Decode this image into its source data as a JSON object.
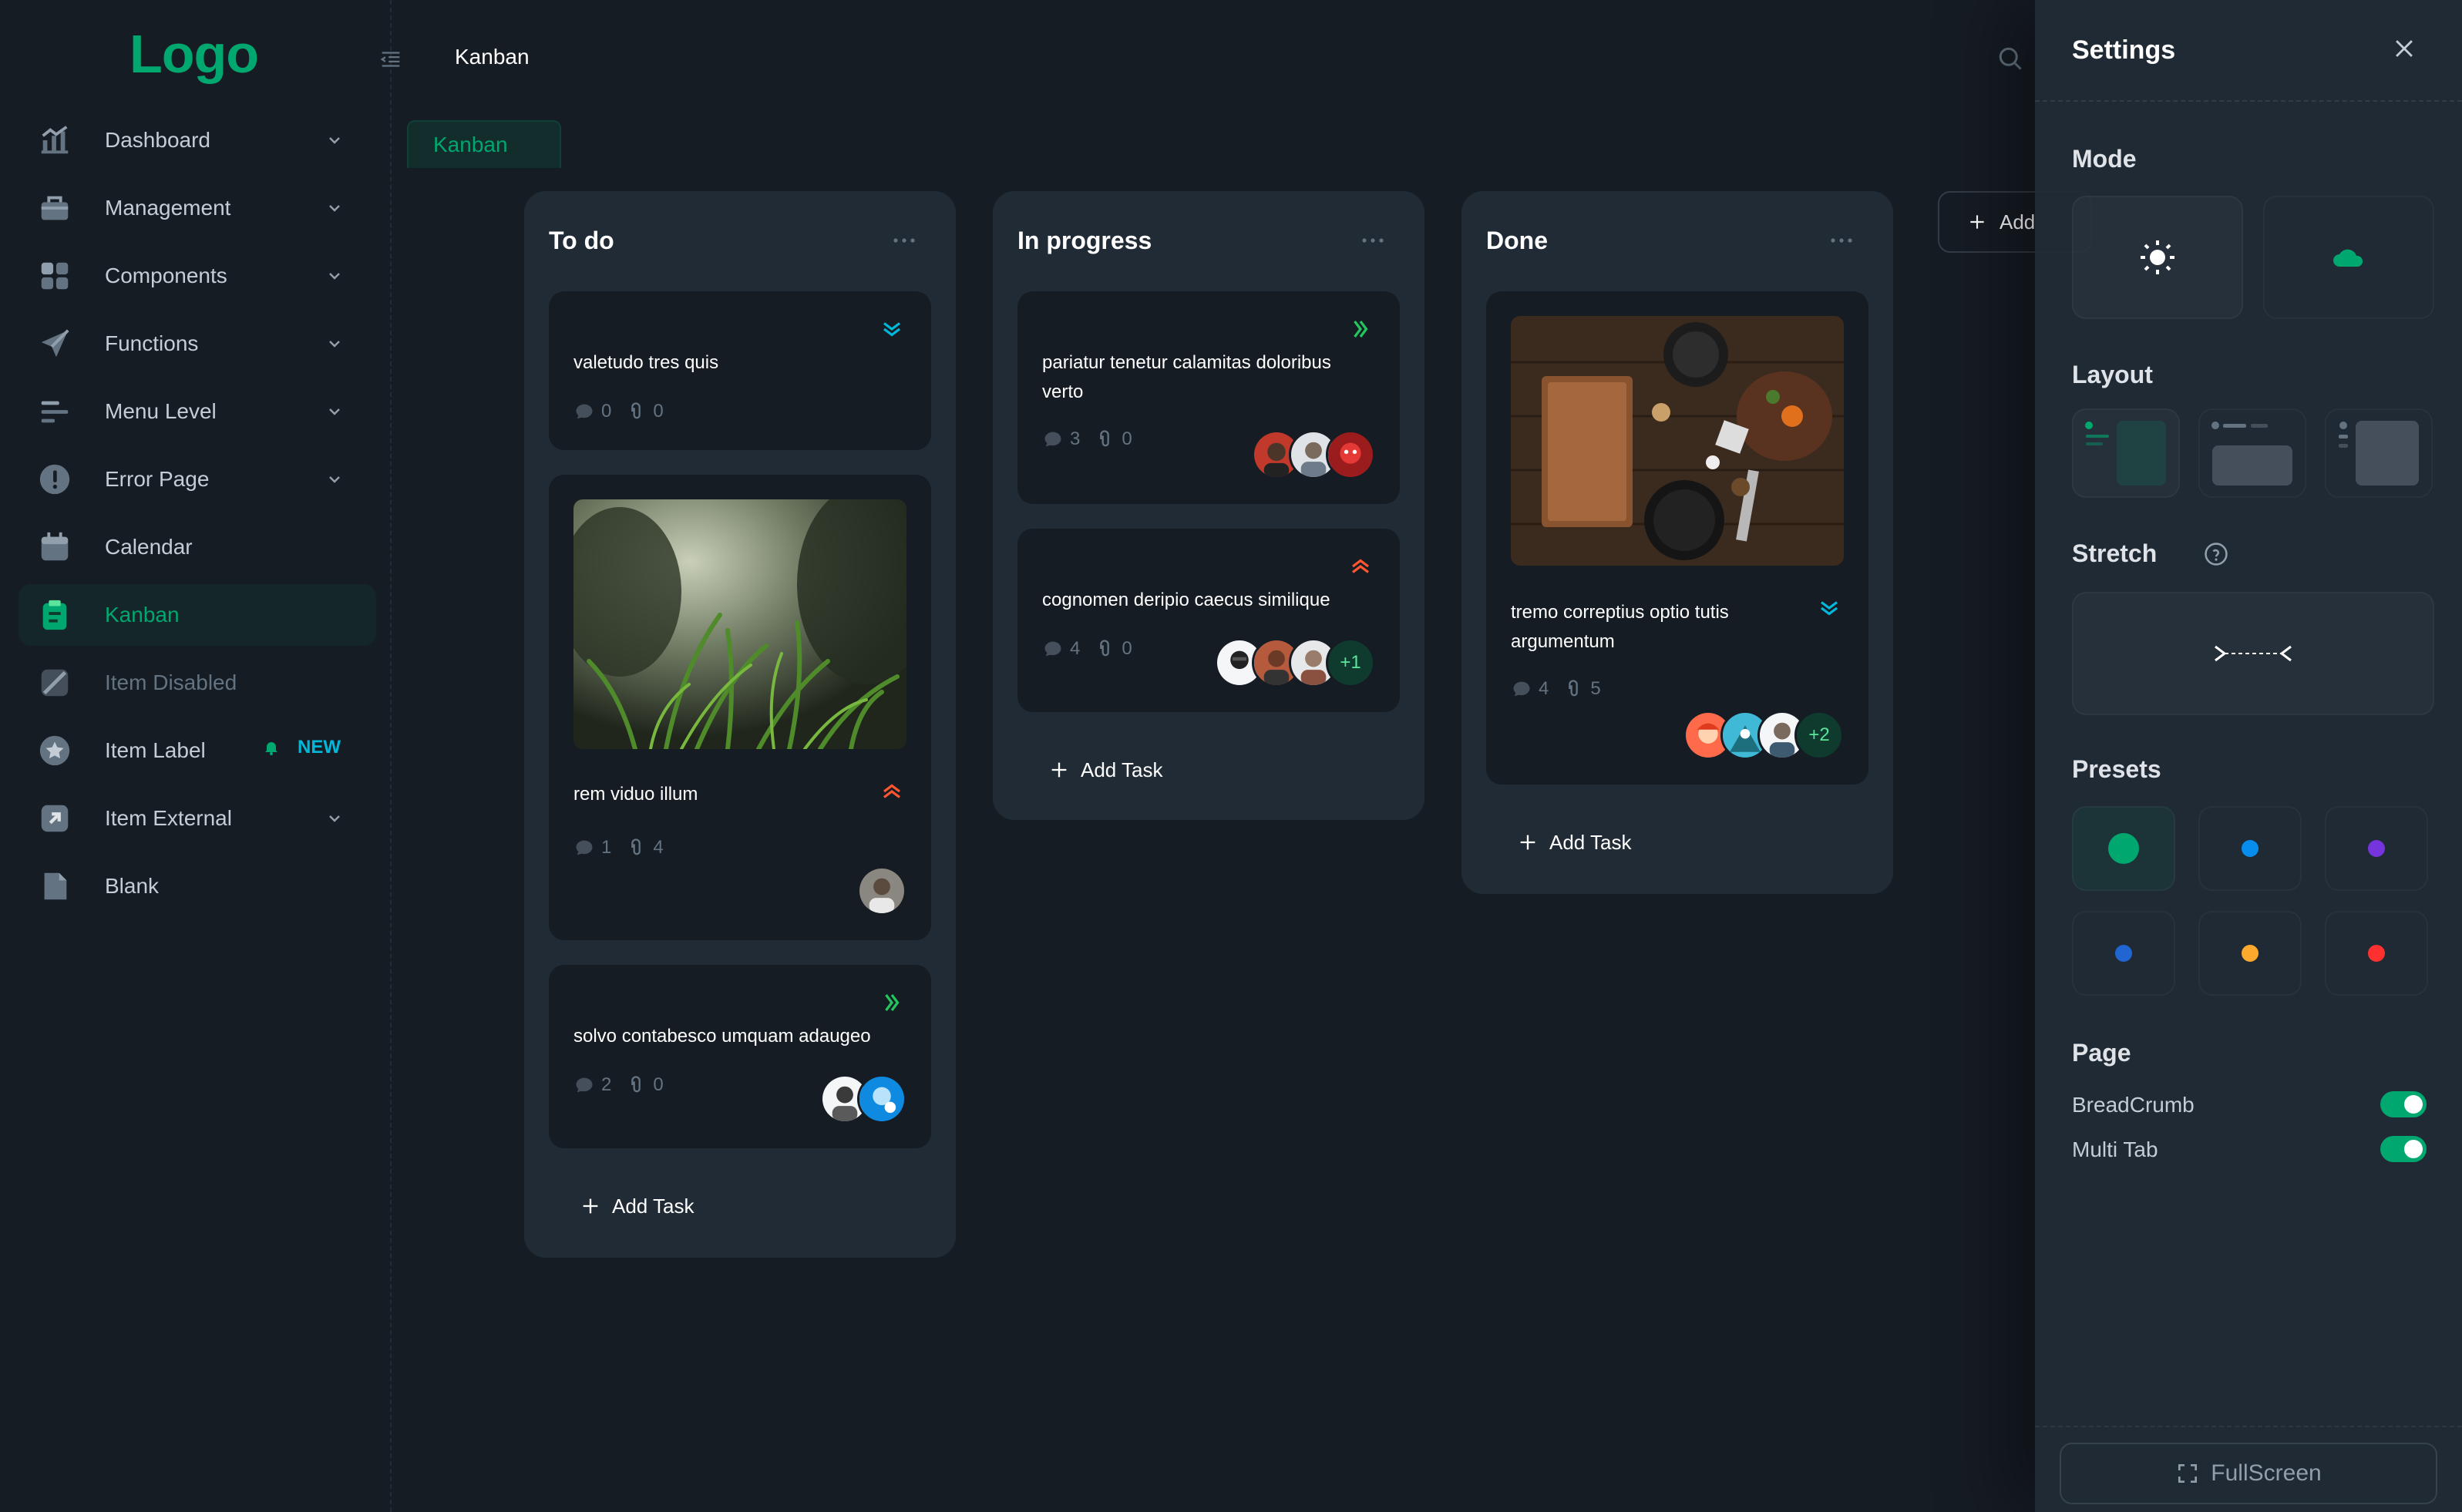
{
  "logo": "Logo",
  "header": {
    "title": "Kanban"
  },
  "tab": {
    "label": "Kanban"
  },
  "sidebar": {
    "items": [
      {
        "label": "Dashboard",
        "icon": "chart-icon",
        "chevron": true
      },
      {
        "label": "Management",
        "icon": "briefcase-icon",
        "chevron": true
      },
      {
        "label": "Components",
        "icon": "grid-icon",
        "chevron": true
      },
      {
        "label": "Functions",
        "icon": "send-icon",
        "chevron": true
      },
      {
        "label": "Menu Level",
        "icon": "menu-lines-icon",
        "chevron": true
      },
      {
        "label": "Error Page",
        "icon": "alert-icon",
        "chevron": true
      },
      {
        "label": "Calendar",
        "icon": "calendar-icon",
        "chevron": false
      },
      {
        "label": "Kanban",
        "icon": "clipboard-icon",
        "chevron": false,
        "active": true
      },
      {
        "label": "Item Disabled",
        "icon": "disabled-icon",
        "chevron": false,
        "disabled": true
      },
      {
        "label": "Item Label",
        "icon": "star-icon",
        "chevron": false,
        "badge": "NEW"
      },
      {
        "label": "Item External",
        "icon": "external-icon",
        "chevron": true
      },
      {
        "label": "Blank",
        "icon": "file-icon",
        "chevron": false
      }
    ]
  },
  "board": {
    "add_column_label": "Add",
    "add_task_label": "Add Task",
    "columns": [
      {
        "title": "To do",
        "cards": [
          {
            "title": "valetudo tres quis",
            "comments": "0",
            "attachments": "0",
            "priority": "low"
          },
          {
            "title": "rem viduo illum",
            "comments": "1",
            "attachments": "4",
            "priority": "high"
          },
          {
            "title": "solvo contabesco umquam adaugeo",
            "comments": "2",
            "attachments": "0",
            "priority": "medium"
          }
        ]
      },
      {
        "title": "In progress",
        "cards": [
          {
            "title": "pariatur tenetur calamitas doloribus verto",
            "comments": "3",
            "attachments": "0",
            "priority": "medium"
          },
          {
            "title": "cognomen deripio caecus similique",
            "comments": "4",
            "attachments": "0",
            "priority": "high",
            "more_assignees": "+1"
          }
        ]
      },
      {
        "title": "Done",
        "cards": [
          {
            "title": "tremo correptius optio tutis argumentum",
            "comments": "4",
            "attachments": "5",
            "priority": "low",
            "more_assignees": "+2"
          }
        ]
      }
    ]
  },
  "settings": {
    "title": "Settings",
    "mode_label": "Mode",
    "layout_label": "Layout",
    "stretch_label": "Stretch",
    "presets_label": "Presets",
    "page_label": "Page",
    "breadcrumb_label": "BreadCrumb",
    "multitab_label": "Multi Tab",
    "fullscreen_label": "FullScreen",
    "preset_colors": [
      "#00a76f",
      "#078dee",
      "#7635dc",
      "#2065d1",
      "#fda92d",
      "#ff3030"
    ],
    "breadcrumb_on": true,
    "multitab_on": true
  },
  "colors": {
    "primary": "#00a76f",
    "background": "#161c24",
    "column": "#212b36"
  }
}
